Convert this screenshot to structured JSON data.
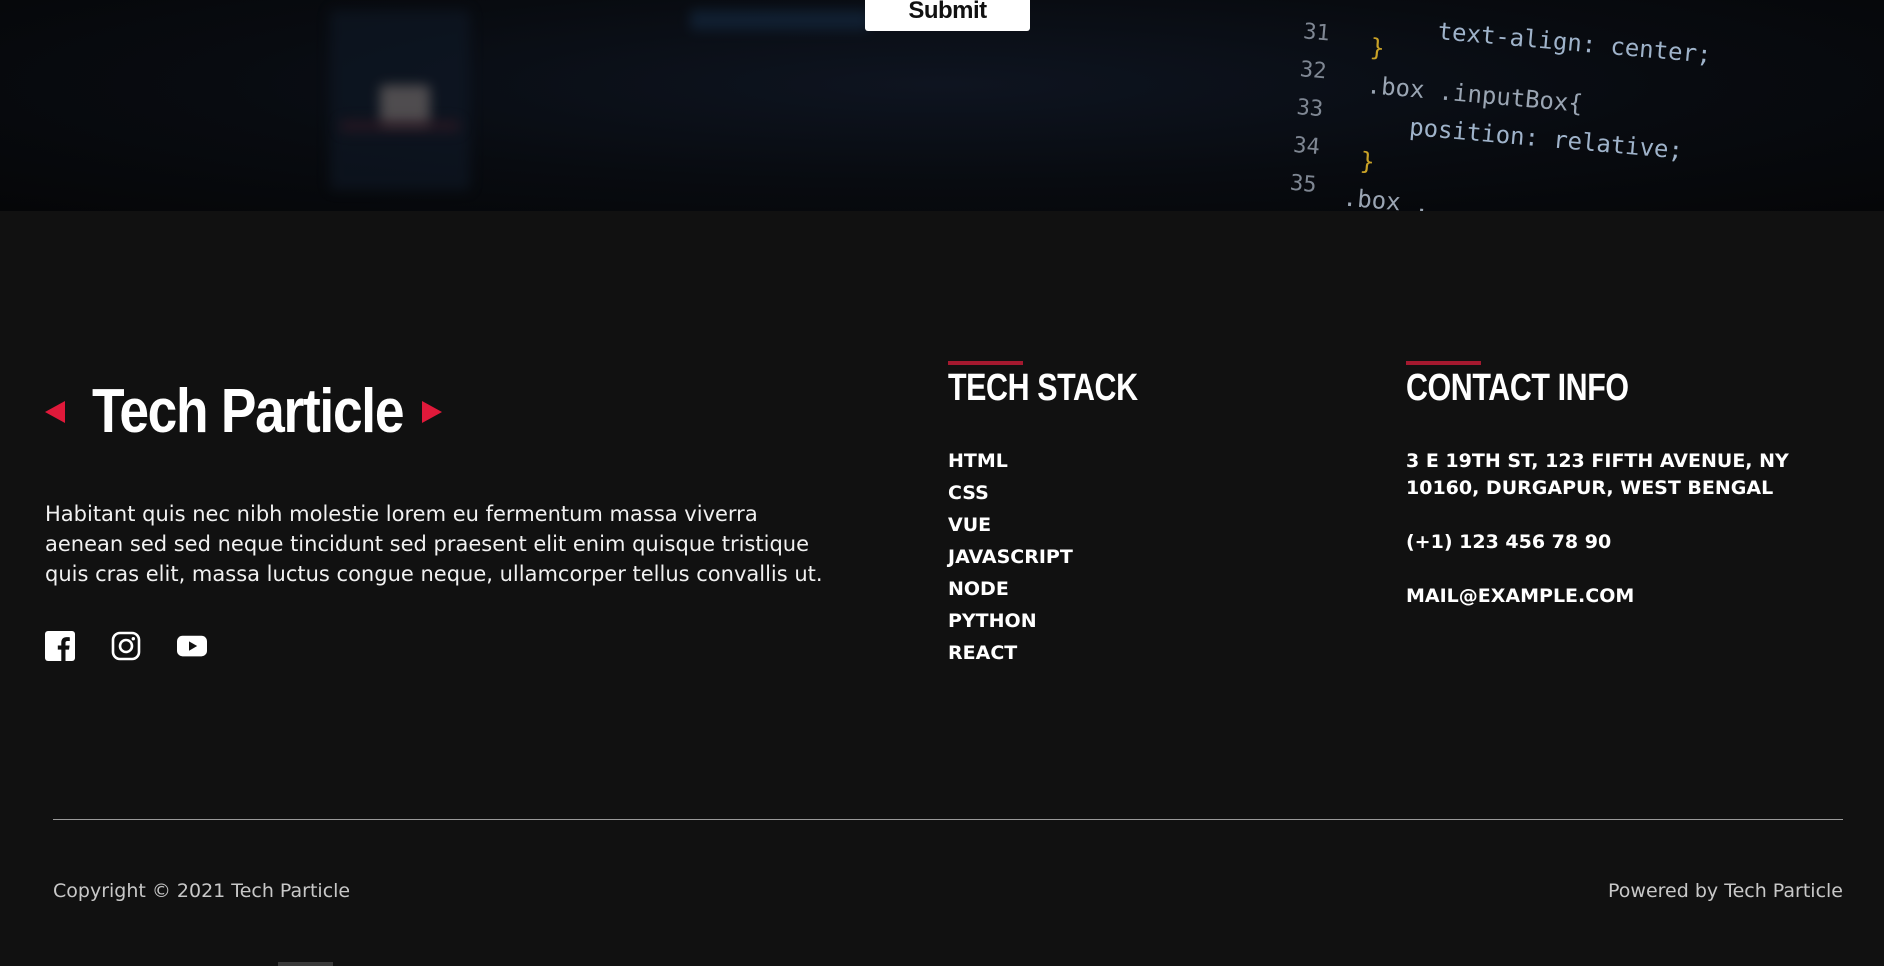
{
  "hero": {
    "submit_label": "Submit",
    "code_lines": [
      {
        "num": "31",
        "text": "text-align: center;",
        "kind": "prop"
      },
      {
        "num": "32",
        "text": "}",
        "kind": "brace"
      },
      {
        "num": "33",
        "text": ".box .inputBox{",
        "kind": "sel"
      },
      {
        "num": "34",
        "text": "position: relative;",
        "kind": "prop"
      },
      {
        "num": "35",
        "text": "}",
        "kind": "brace"
      },
      {
        "num": "",
        "text": ".box .",
        "kind": "sel"
      }
    ]
  },
  "footer": {
    "brand": "Tech Particle",
    "about": "Habitant quis nec nibh molestie lorem eu fermentum massa viverra aenean sed sed neque tincidunt sed praesent elit enim quisque tristique quis cras elit, massa luctus congue neque, ullamcorper tellus convallis ut.",
    "socials": [
      {
        "icon": "facebook-icon"
      },
      {
        "icon": "instagram-icon"
      },
      {
        "icon": "youtube-icon"
      }
    ],
    "tech_stack": {
      "title": "TECH STACK",
      "items": [
        "HTML",
        "CSS",
        "VUE",
        "JAVASCRIPT",
        "NODE",
        "PYTHON",
        "REACT"
      ]
    },
    "contact": {
      "title": "CONTACT INFO",
      "address_line1": "3 E 19TH ST, 123 FIFTH AVENUE, NY",
      "address_line2": "10160, DURGAPUR, WEST BENGAL",
      "phone": "(+1) 123 456 78 90",
      "email": "MAIL@EXAMPLE.COM"
    },
    "copyright": "Copyright © 2021 Tech Particle",
    "powered_by": "Powered by Tech Particle",
    "colors": {
      "accent": "#e0193a",
      "heading_bar": "#a4192f",
      "background": "#111111"
    }
  }
}
